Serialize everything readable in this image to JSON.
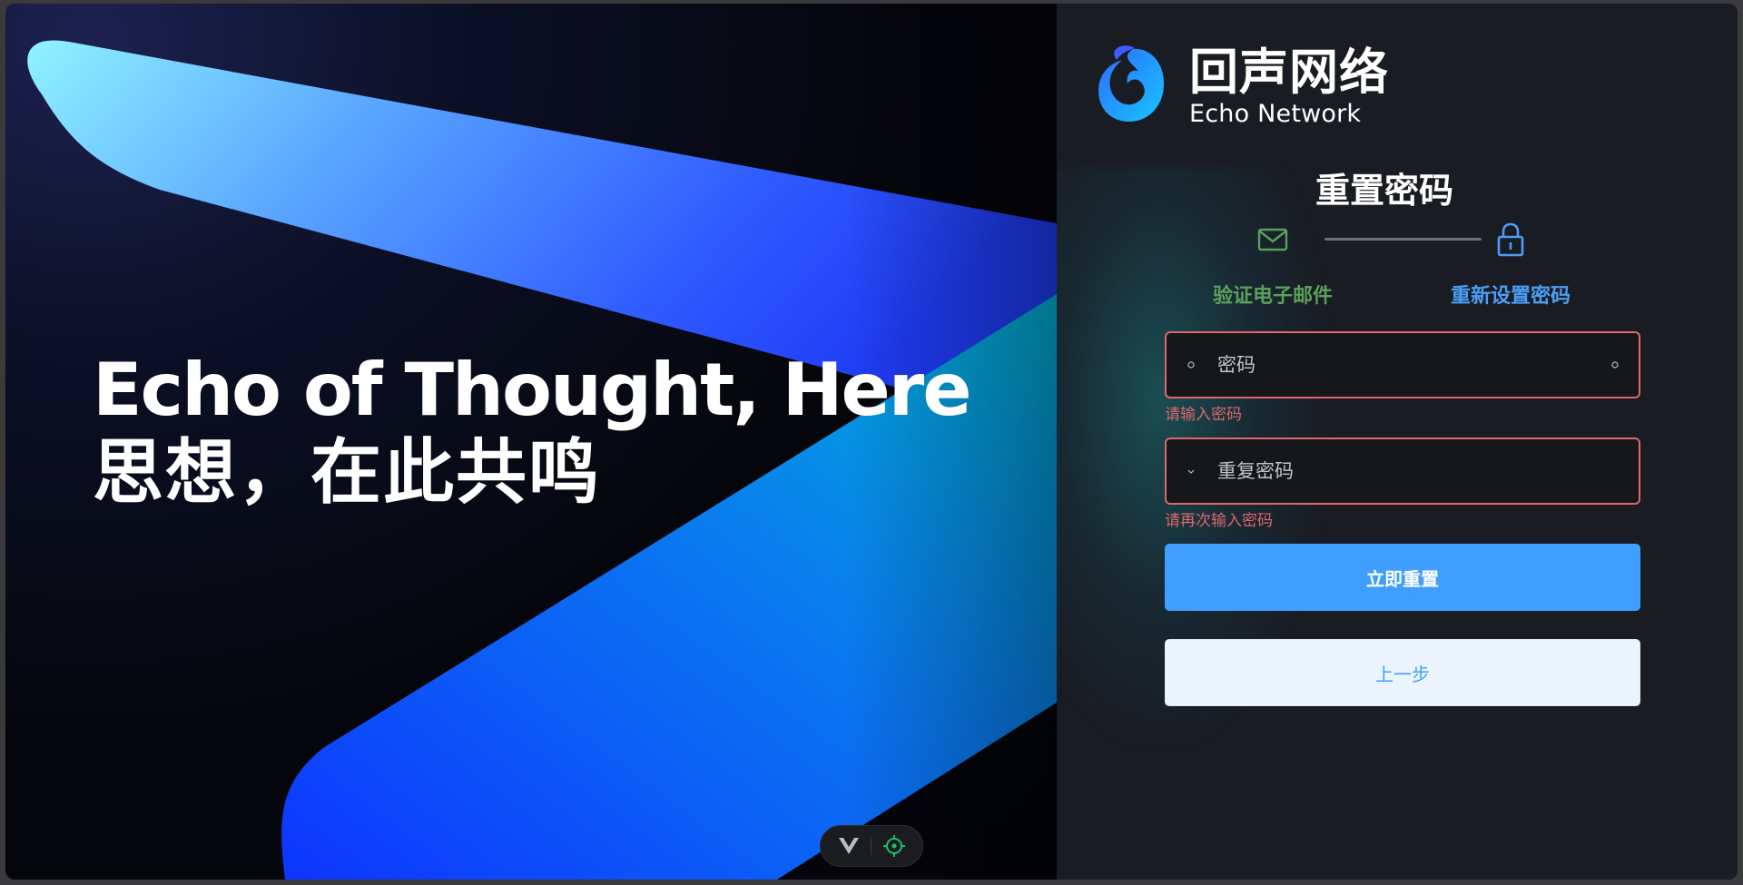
{
  "hero": {
    "title": "Echo of Thought, Here",
    "subtitle": "思想，在此共鸣"
  },
  "devtools": {
    "vue_icon": "vue-logo-icon",
    "inspect_icon": "crosshair-icon"
  },
  "brand": {
    "name_cn": "回声网络",
    "name_en": "Echo Network",
    "logo_icon": "swirl-logo-icon"
  },
  "form": {
    "title": "重置密码",
    "steps": [
      {
        "label": "验证电子邮件",
        "icon": "mail-icon",
        "status": "completed"
      },
      {
        "label": "重新设置密码",
        "icon": "lock-icon",
        "status": "active"
      }
    ],
    "password": {
      "placeholder": "密码",
      "error": "请输入密码"
    },
    "repeat_password": {
      "placeholder": "重复密码",
      "error": "请再次输入密码"
    },
    "submit_label": "立即重置",
    "back_label": "上一步"
  },
  "colors": {
    "primary": "#409eff",
    "error": "#e0666b",
    "step_done": "#5aa05c",
    "step_active": "#4a9ef5"
  }
}
